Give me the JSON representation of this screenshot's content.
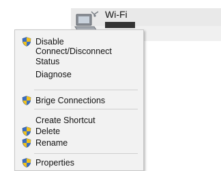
{
  "adapter": {
    "name": "Wi-Fi",
    "icon": "network-adapter-icon"
  },
  "menu": {
    "items": [
      {
        "label": "Disable",
        "icon": "shield-icon"
      },
      {
        "label": "Connect/Disconnect"
      },
      {
        "label": "Status"
      },
      {
        "label": "Diagnose"
      },
      {
        "label": "Brige Connections",
        "icon": "shield-icon"
      },
      {
        "label": "Create Shortcut"
      },
      {
        "label": "Delete",
        "icon": "shield-icon"
      },
      {
        "label": "Rename",
        "icon": "shield-icon"
      },
      {
        "label": "Properties",
        "icon": "shield-icon"
      }
    ]
  },
  "colors": {
    "menu_background": "#f2f2f2",
    "separator": "#cfcfcf",
    "shield_blue": "#3b6fc2",
    "shield_yellow": "#f2c21b"
  }
}
